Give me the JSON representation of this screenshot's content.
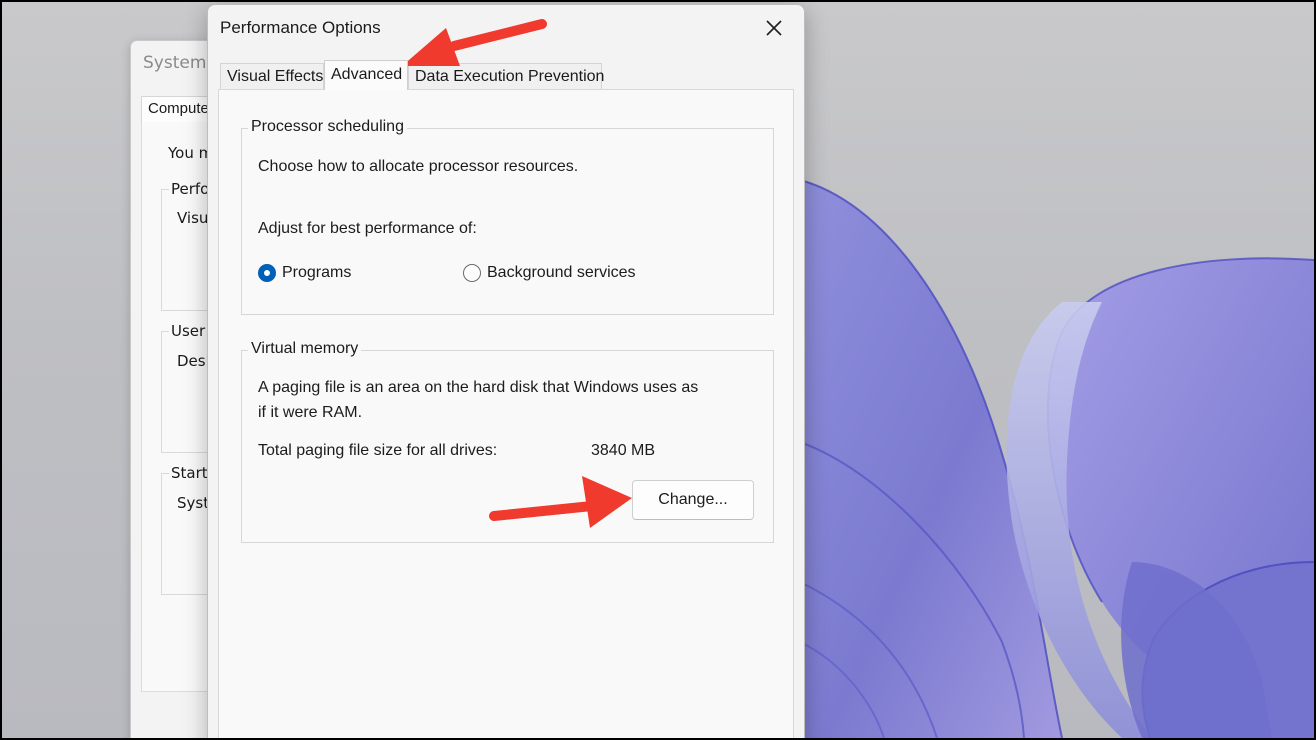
{
  "background_window": {
    "title": "System P",
    "tab": "Computer",
    "intro_text": "You m",
    "groups": [
      {
        "label": "Perfo",
        "line": "Visu"
      },
      {
        "label": "User",
        "line": "Desk"
      },
      {
        "label": "Startu",
        "line": "Syst"
      }
    ]
  },
  "dialog": {
    "title": "Performance Options",
    "tabs": [
      {
        "label": "Visual Effects",
        "active": false
      },
      {
        "label": "Advanced",
        "active": true
      },
      {
        "label": "Data Execution Prevention",
        "active": false
      }
    ],
    "processor_scheduling": {
      "legend": "Processor scheduling",
      "description": "Choose how to allocate processor resources.",
      "adjust_label": "Adjust for best performance of:",
      "options": [
        {
          "label": "Programs",
          "checked": true
        },
        {
          "label": "Background services",
          "checked": false
        }
      ]
    },
    "virtual_memory": {
      "legend": "Virtual memory",
      "description_line1": "A paging file is an area on the hard disk that Windows uses as",
      "description_line2": "if it were RAM.",
      "total_label": "Total paging file size for all drives:",
      "total_value": "3840 MB",
      "change_button": "Change..."
    }
  },
  "colors": {
    "accent": "#005fb8",
    "annotation_arrow": "#f03a2e",
    "wallpaper_petal": "#7f7ed0"
  },
  "icons": {
    "close": "close-icon",
    "annotation": "arrow-annotation"
  }
}
